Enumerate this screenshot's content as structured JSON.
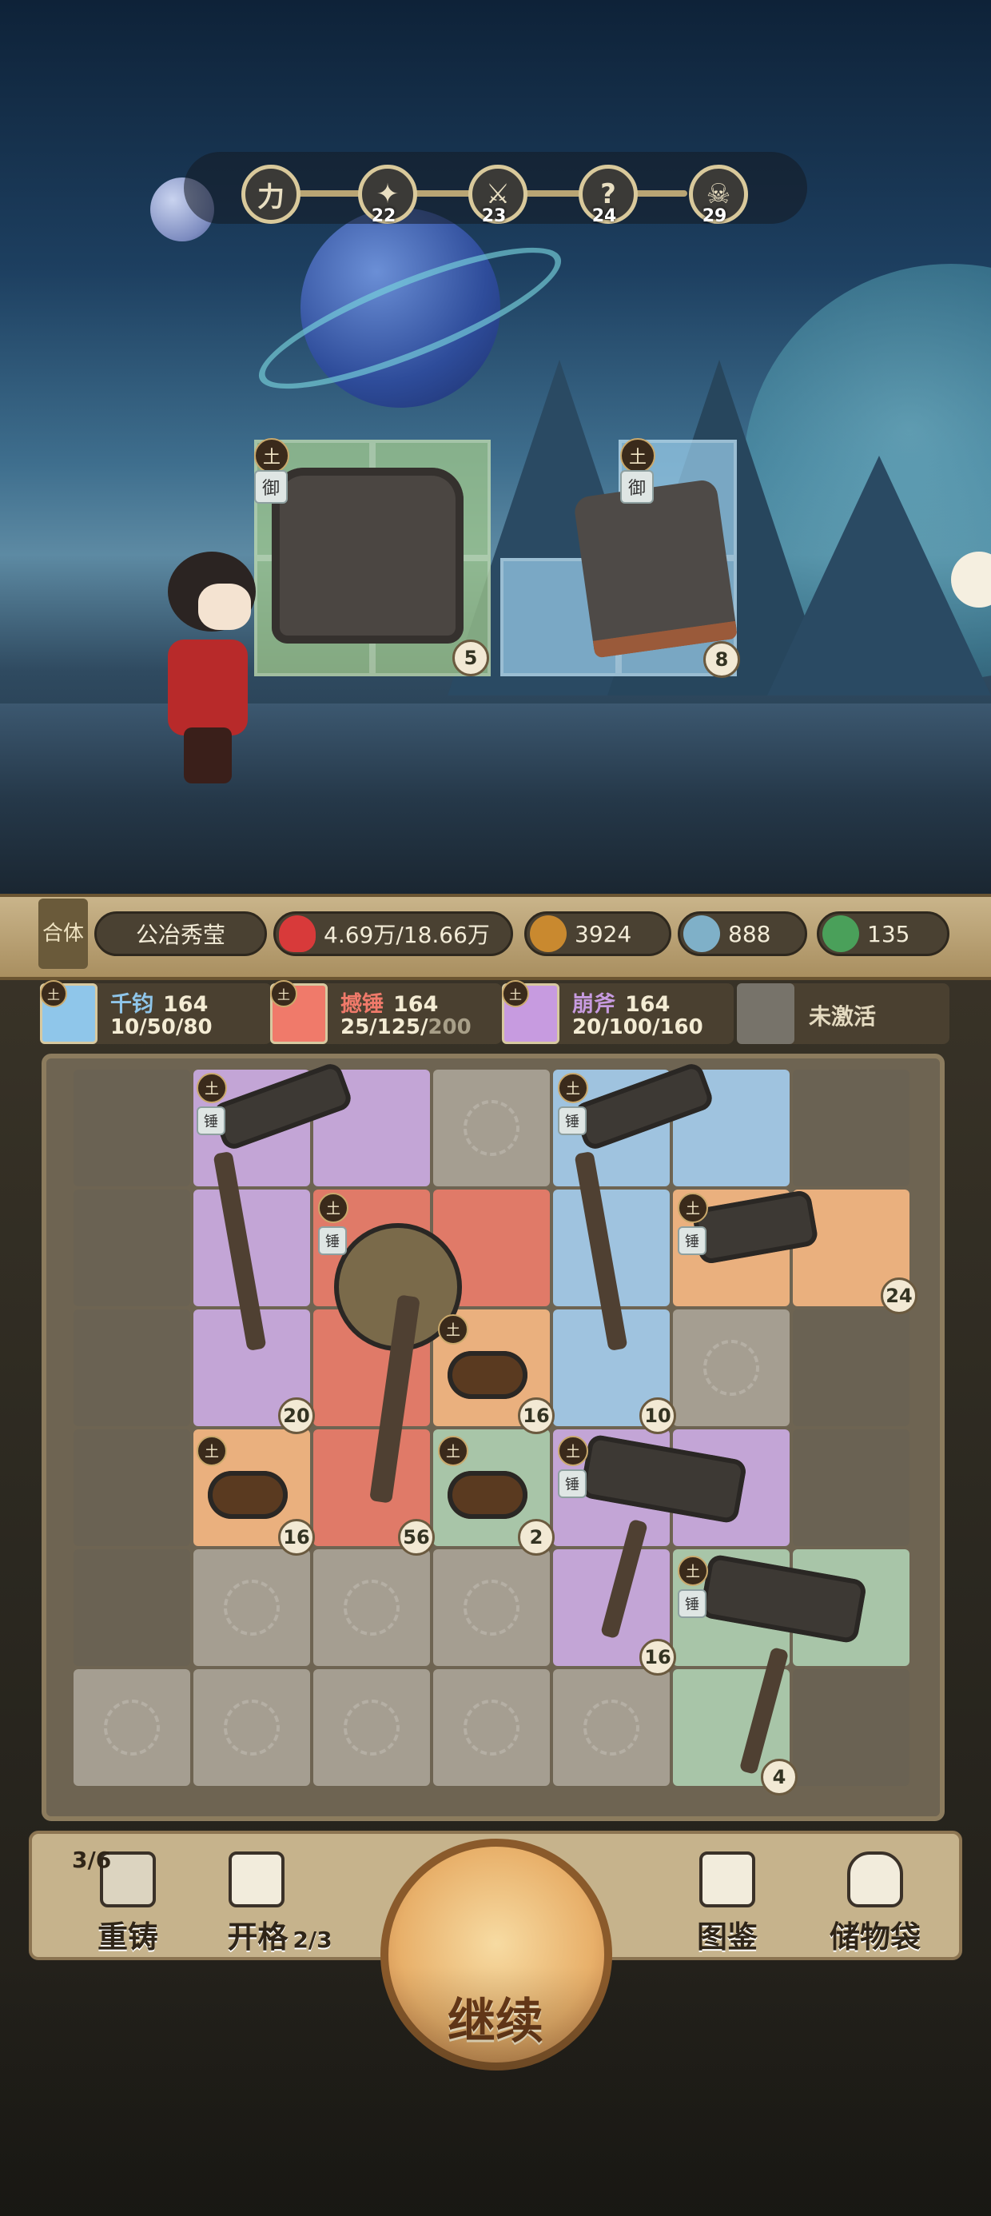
{
  "stage_tracker": {
    "nodes": [
      {
        "icon": "start-rune-icon",
        "glyph": "力",
        "label": ""
      },
      {
        "icon": "arm-strength-icon",
        "glyph": "✦",
        "label": "22"
      },
      {
        "icon": "crossed-swords-icon",
        "glyph": "⚔",
        "label": "23"
      },
      {
        "icon": "question-icon",
        "glyph": "?",
        "label": "24"
      },
      {
        "icon": "boss-icon",
        "glyph": "☠",
        "label": "29"
      }
    ]
  },
  "enemy_items": [
    {
      "element": "土",
      "tag": "御",
      "count": "5",
      "color": "#a8c8a0"
    },
    {
      "element": "土",
      "tag": "御",
      "count": "8",
      "color": "#9cc8e6"
    }
  ],
  "hud": {
    "mode": "合体",
    "name": "公冶秀莹",
    "hp": "4.69万/18.66万",
    "attack": "3924",
    "defense": "888",
    "currency": "135"
  },
  "skills": [
    {
      "element": "土",
      "name": "千钧",
      "level": "164",
      "nums": "10/50/80",
      "dim": "",
      "color": "#8fc6ea"
    },
    {
      "element": "土",
      "name": "撼锤",
      "level": "164",
      "nums": "25/125/",
      "dim": "200",
      "color": "#f07a6a"
    },
    {
      "element": "土",
      "name": "崩斧",
      "level": "164",
      "nums": "20/100/160",
      "dim": "",
      "color": "#c79be0"
    },
    {
      "element": "",
      "name": "未激活",
      "level": "",
      "nums": "",
      "dim": "",
      "color": "#e4dac0"
    }
  ],
  "board": {
    "badges": {
      "earth": "土",
      "hammer": "锤"
    },
    "counts": [
      "24",
      "20",
      "16",
      "10",
      "16",
      "56",
      "2",
      "16",
      "4"
    ]
  },
  "actions": {
    "reforge": {
      "label": "重铸",
      "badge": "3/6"
    },
    "expand": {
      "label": "开格",
      "badge": "2/3"
    },
    "codex": {
      "label": "图鉴"
    },
    "bag": {
      "label": "储物袋"
    },
    "continue": {
      "label": "继续"
    }
  }
}
